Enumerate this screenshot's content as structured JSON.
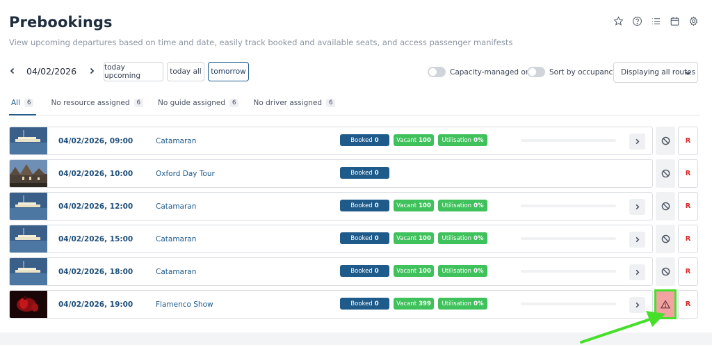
{
  "header": {
    "title": "Prebookings",
    "subtitle": "View upcoming departures based on time and date, easily track booked and available seats, and access passenger manifests"
  },
  "top_icons": [
    "star-icon",
    "help-icon",
    "list-icon",
    "calendar-icon",
    "gear-icon"
  ],
  "date_nav": {
    "date": "04/02/2026"
  },
  "quick_filters": {
    "today_upcoming": "today upcoming",
    "today_all": "today all",
    "tomorrow": "tomorrow"
  },
  "toggles": {
    "capacity": "Capacity-managed only",
    "occupancy": "Sort by occupancy"
  },
  "route_select": {
    "value": "Displaying all routes"
  },
  "tabs": [
    {
      "label": "All",
      "count": "6"
    },
    {
      "label": "No resource assigned",
      "count": "6"
    },
    {
      "label": "No guide assigned",
      "count": "6"
    },
    {
      "label": "No driver assigned",
      "count": "6"
    }
  ],
  "labels": {
    "booked": "Booked",
    "vacant": "Vacant",
    "utilisation": "Utilisation",
    "r": "R"
  },
  "rows": [
    {
      "datetime": "04/02/2026, 09:00",
      "tour": "Catamaran",
      "booked": "0",
      "vacant": "100",
      "utilisation": "0%"
    },
    {
      "datetime": "04/02/2026, 10:00",
      "tour": "Oxford Day Tour",
      "booked": "0"
    },
    {
      "datetime": "04/02/2026, 12:00",
      "tour": "Catamaran",
      "booked": "0",
      "vacant": "100",
      "utilisation": "0%"
    },
    {
      "datetime": "04/02/2026, 15:00",
      "tour": "Catamaran",
      "booked": "0",
      "vacant": "100",
      "utilisation": "0%"
    },
    {
      "datetime": "04/02/2026, 18:00",
      "tour": "Catamaran",
      "booked": "0",
      "vacant": "100",
      "utilisation": "0%"
    },
    {
      "datetime": "04/02/2026, 19:00",
      "tour": "Flamenco Show",
      "booked": "0",
      "vacant": "399",
      "utilisation": "0%"
    }
  ],
  "colors": {
    "accent": "#1e5a8a",
    "success": "#3fc15b",
    "danger": "#dc2626",
    "annotation": "#46e02a"
  }
}
